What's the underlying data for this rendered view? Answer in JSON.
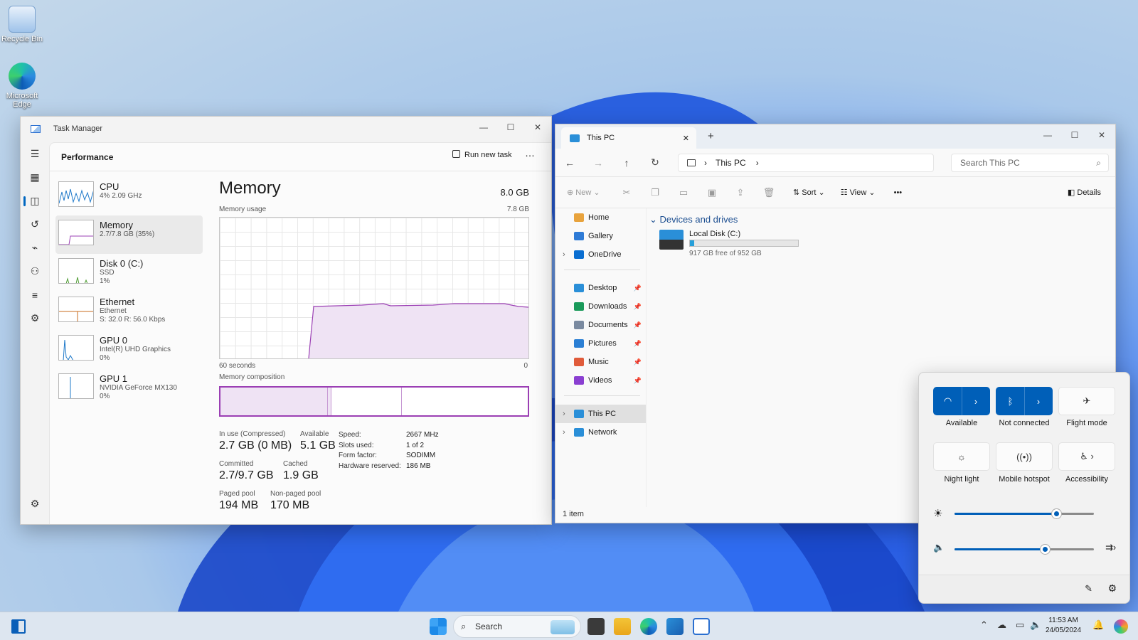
{
  "desktop": {
    "icons": [
      {
        "label": "Recycle Bin",
        "icon": "recycle-bin-icon"
      },
      {
        "label": "Microsoft Edge",
        "icon": "edge-icon"
      }
    ]
  },
  "task_manager": {
    "title": "Task Manager",
    "section": "Performance",
    "run_new_task": "Run new task",
    "more": "…",
    "items": [
      {
        "name": "CPU",
        "sub1": "4% 2.09 GHz",
        "sub2": ""
      },
      {
        "name": "Memory",
        "sub1": "2.7/7.8 GB (35%)",
        "sub2": ""
      },
      {
        "name": "Disk 0 (C:)",
        "sub1": "SSD",
        "sub2": "1%"
      },
      {
        "name": "Ethernet",
        "sub1": "Ethernet",
        "sub2": "S: 32.0 R: 56.0 Kbps"
      },
      {
        "name": "GPU 0",
        "sub1": "Intel(R) UHD Graphics",
        "sub2": "0%"
      },
      {
        "name": "GPU 1",
        "sub1": "NVIDIA GeForce MX130",
        "sub2": "0%"
      }
    ],
    "detail": {
      "title": "Memory",
      "total": "8.0 GB",
      "usage_label": "Memory usage",
      "usage_max": "7.8 GB",
      "x_left": "60 seconds",
      "x_right": "0",
      "composition_label": "Memory composition",
      "composition_in_use_fraction": 0.35,
      "stats": [
        {
          "label": "In use (Compressed)",
          "value": "2.7 GB (0 MB)"
        },
        {
          "label": "Available",
          "value": "5.1 GB"
        },
        {
          "label": "Committed",
          "value": "2.7/9.7 GB"
        },
        {
          "label": "Cached",
          "value": "1.9 GB"
        },
        {
          "label": "Paged pool",
          "value": "194 MB"
        },
        {
          "label": "Non-paged pool",
          "value": "170 MB"
        }
      ],
      "kv": [
        {
          "k": "Speed:",
          "v": "2667 MHz"
        },
        {
          "k": "Slots used:",
          "v": "1 of 2"
        },
        {
          "k": "Form factor:",
          "v": "SODIMM"
        },
        {
          "k": "Hardware reserved:",
          "v": "186 MB"
        }
      ]
    }
  },
  "explorer": {
    "tab_title": "This PC",
    "add_tab": "+",
    "close_tab": "✕",
    "crumb": "This PC",
    "search_placeholder": "Search This PC",
    "cmd": {
      "new": "New",
      "sort": "Sort",
      "view": "View",
      "more": "•••",
      "details": "Details"
    },
    "nav": [
      {
        "label": "Home",
        "color": "#e8a33d",
        "pinned": false
      },
      {
        "label": "Gallery",
        "color": "#2e7bd6",
        "pinned": false
      },
      {
        "label": "OneDrive",
        "color": "#0a6ed1",
        "pinned": false
      },
      {
        "label": "Desktop",
        "color": "#2a8fd8",
        "pinned": true
      },
      {
        "label": "Downloads",
        "color": "#1a9a5a",
        "pinned": true
      },
      {
        "label": "Documents",
        "color": "#7a8aa0",
        "pinned": true
      },
      {
        "label": "Pictures",
        "color": "#2b7fd4",
        "pinned": true
      },
      {
        "label": "Music",
        "color": "#e05b3a",
        "pinned": true
      },
      {
        "label": "Videos",
        "color": "#8a3fd1",
        "pinned": true
      },
      {
        "label": "This PC",
        "color": "#2a8fd8",
        "pinned": false
      },
      {
        "label": "Network",
        "color": "#2a8fd8",
        "pinned": false
      }
    ],
    "group": "Devices and drives",
    "drive": {
      "name": "Local Disk (C:)",
      "free": "917 GB free of 952 GB",
      "used_fraction": 0.037
    },
    "status": "1 item"
  },
  "quick_settings": {
    "tiles": [
      {
        "label": "Available",
        "icon": "wifi-icon",
        "on": true
      },
      {
        "label": "Not connected",
        "icon": "bluetooth-icon",
        "on": true
      },
      {
        "label": "Flight mode",
        "icon": "airplane-icon",
        "on": false
      },
      {
        "label": "Night light",
        "icon": "night-light-icon",
        "on": false
      },
      {
        "label": "Mobile hotspot",
        "icon": "hotspot-icon",
        "on": false
      },
      {
        "label": "Accessibility",
        "icon": "accessibility-icon",
        "on": false
      }
    ],
    "brightness": 0.73,
    "volume": 0.65
  },
  "taskbar": {
    "search": "Search",
    "time": "11:53 AM",
    "date": "24/05/2024"
  }
}
